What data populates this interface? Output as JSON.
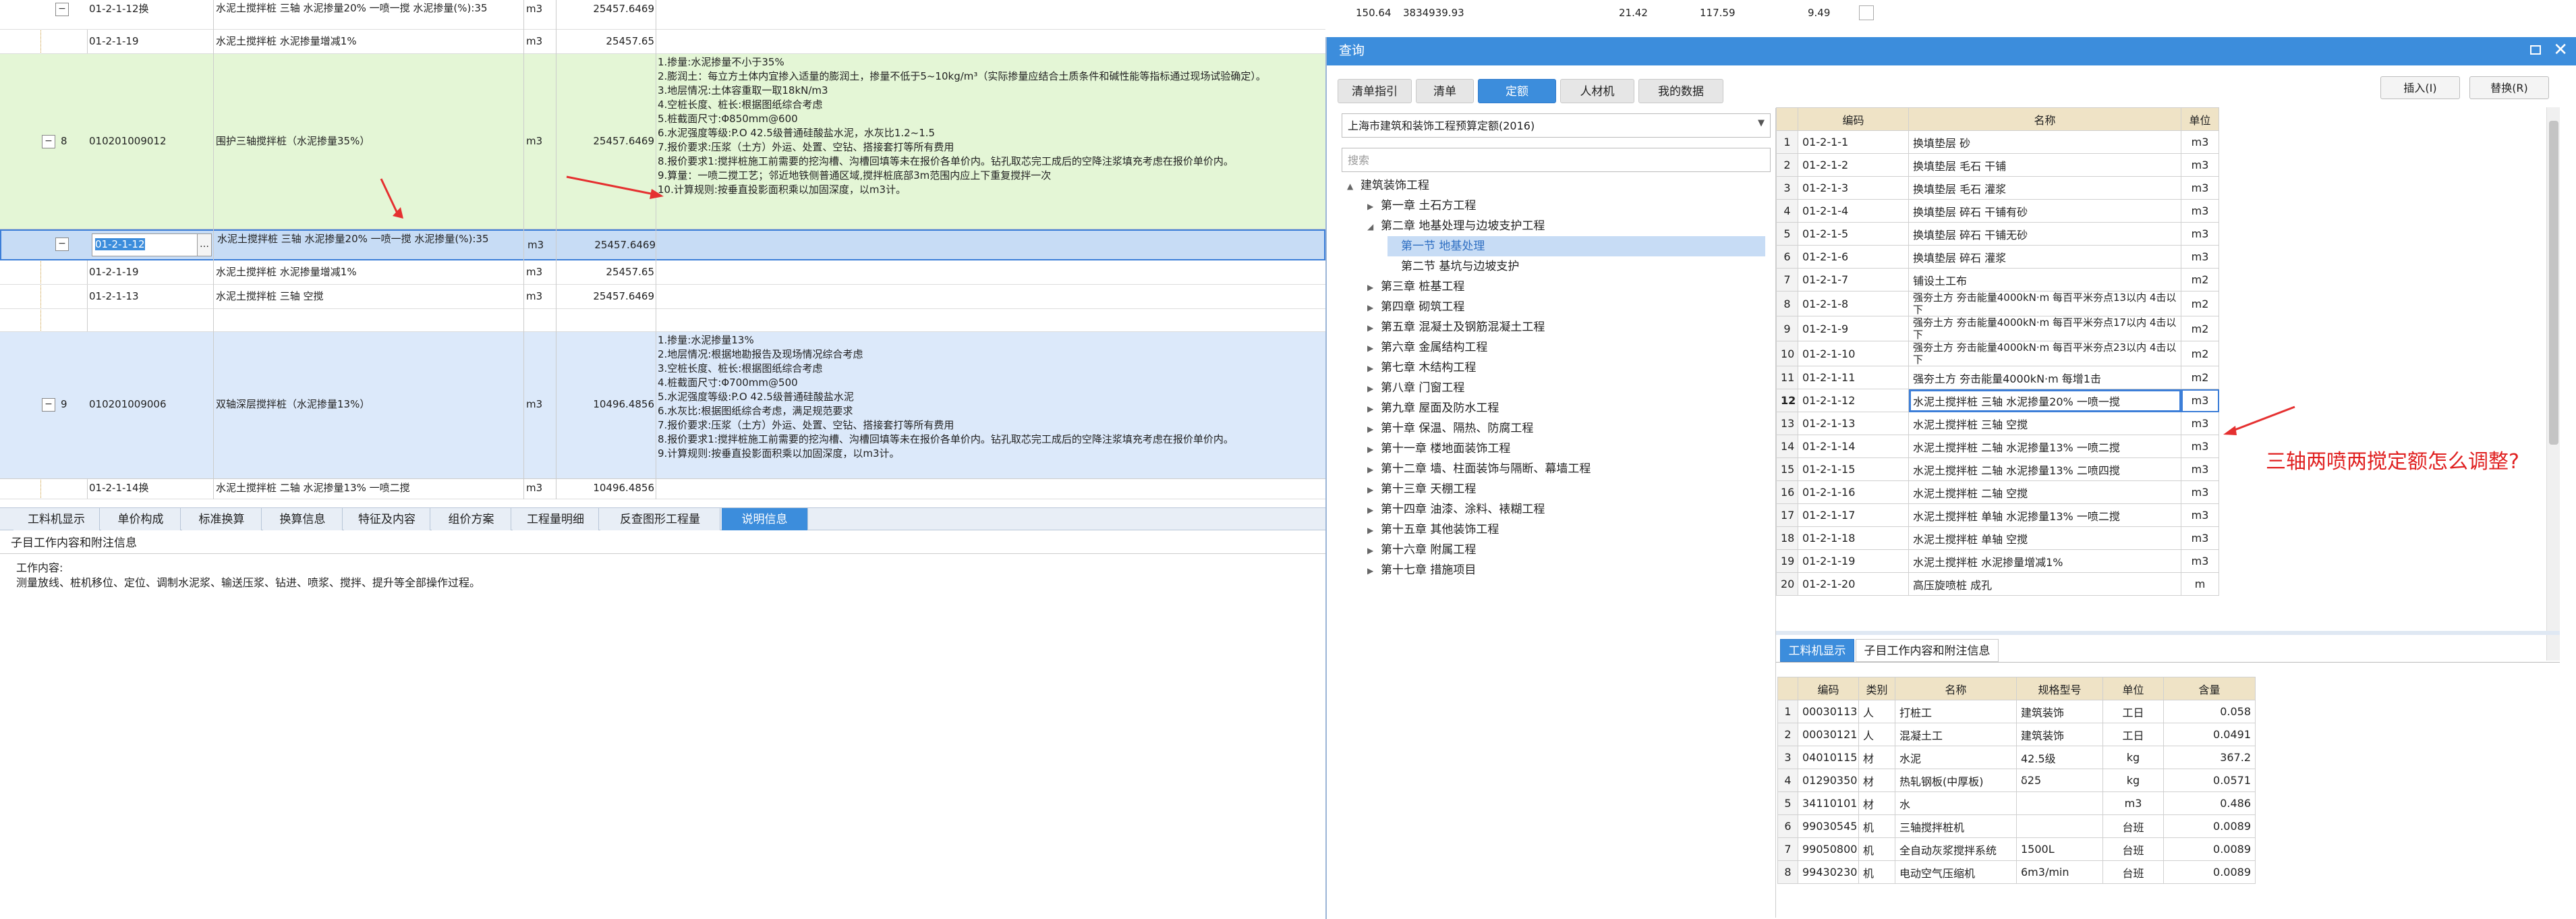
{
  "top_rows": [
    {
      "code": "01-2-1-12换",
      "name": "水泥土搅拌桩 三轴 水泥掺量20% 一喷一搅 水泥掺量(%):35",
      "unit": "m3",
      "qty": "25457.6469"
    },
    {
      "code": "01-2-1-19",
      "name": "水泥土搅拌桩 水泥掺量增减1%",
      "unit": "m3",
      "qty": "25457.65"
    }
  ],
  "top_right": {
    "v1": "150.64",
    "v2": "3834939.93",
    "v3": "21.42",
    "v4": "117.59",
    "v5": "9.49"
  },
  "row8": {
    "seq": "8",
    "code": "010201009012",
    "name": "围护三轴搅拌桩（水泥掺量35%）",
    "unit": "m3",
    "qty": "25457.6469",
    "desc": "1.掺量:水泥掺量不小于35%\n2.膨润土：每立方土体内宜掺入适量的膨润土，掺量不低于5~10kg/m³（实际掺量应结合土质条件和碱性能等指标通过现场试验确定）。\n3.地层情况:土体容重取一取18kN/m3\n4.空桩长度、桩长:根据图纸综合考虑\n5.桩截面尺寸:Φ850mm@600\n6.水泥强度等级:P.O 42.5级普通硅酸盐水泥，水灰比1.2~1.5\n7.报价要求:压浆（土方）外运、处置、空钻、搭接套打等所有费用\n8.报价要求1:搅拌桩施工前需要的挖沟槽、沟槽回填等未在报价各单价内。钻孔取芯完工成后的空降注浆填充考虑在报价单价内。\n9.算量：一喷二搅工艺；邻近地铁侧普通区域,搅拌桩底部3m范围内应上下重复搅拌一次\n10.计算规则:按垂直投影面积乘以加固深度，以m3计。"
  },
  "row_sel": {
    "code": "01-2-1-12",
    "name": "水泥土搅拌桩 三轴 水泥掺量20% 一喷一搅 水泥掺量(%):35",
    "unit": "m3",
    "qty": "25457.6469"
  },
  "sub_rows": [
    {
      "code": "01-2-1-19",
      "name": "水泥土搅拌桩 水泥掺量增减1%",
      "unit": "m3",
      "qty": "25457.65"
    },
    {
      "code": "01-2-1-13",
      "name": "水泥土搅拌桩 三轴 空搅",
      "unit": "m3",
      "qty": "25457.6469"
    }
  ],
  "row9": {
    "seq": "9",
    "code": "010201009006",
    "name": "双轴深层搅拌桩（水泥掺量13%）",
    "unit": "m3",
    "qty": "10496.4856",
    "desc": "1.掺量:水泥掺量13%\n2.地层情况:根据地勘报告及现场情况综合考虑\n3.空桩长度、桩长:根据图纸综合考虑\n4.桩截面尺寸:Φ700mm@500\n5.水泥强度等级:P.O 42.5级普通硅酸盐水泥\n6.水灰比:根据图纸综合考虑，满足规范要求\n7.报价要求:压浆（土方）外运、处置、空钻、搭接套打等所有费用\n8.报价要求1:搅拌桩施工前需要的挖沟槽、沟槽回填等未在报价各单价内。钻孔取芯完工成后的空降注浆填充考虑在报价单价内。\n9.计算规则:按垂直投影面积乘以加固深度，以m3计。"
  },
  "row_last": {
    "code": "01-2-1-14换",
    "name": "水泥土搅拌桩 二轴 水泥掺量13% 一喷二搅",
    "unit": "m3",
    "qty": "10496.4856"
  },
  "bottom_tabs": [
    "工料机显示",
    "单价构成",
    "标准换算",
    "换算信息",
    "特征及内容",
    "组价方案",
    "工程量明细",
    "反查图形工程量",
    "说明信息"
  ],
  "bottom_active": "说明信息",
  "bottom_panel": {
    "header": "子目工作内容和附注信息",
    "label": "工作内容:",
    "content": "测量放线、桩机移位、定位、调制水泥浆、输送压浆、钻进、喷浆、搅拌、提升等全部操作过程。"
  },
  "dialog": {
    "title": "查询",
    "tabs": [
      "清单指引",
      "清单",
      "定额",
      "人材机",
      "我的数据"
    ],
    "active_tab": "定额",
    "insert_label": "插入(I)",
    "replace_label": "替换(R)",
    "library": "上海市建筑和装饰工程预算定额(2016)",
    "search_placeholder": "搜索",
    "tree": [
      {
        "label": "建筑装饰工程",
        "level": 0,
        "toggle": "▲"
      },
      {
        "label": "第一章 土石方工程",
        "level": 1,
        "toggle": "▶"
      },
      {
        "label": "第二章 地基处理与边坡支护工程",
        "level": 1,
        "toggle": "◢"
      },
      {
        "label": "第一节 地基处理",
        "level": 2,
        "toggle": "",
        "selected": true
      },
      {
        "label": "第二节 基坑与边坡支护",
        "level": 2,
        "toggle": ""
      },
      {
        "label": "第三章 桩基工程",
        "level": 1,
        "toggle": "▶"
      },
      {
        "label": "第四章 砌筑工程",
        "level": 1,
        "toggle": "▶"
      },
      {
        "label": "第五章 混凝土及钢筋混凝土工程",
        "level": 1,
        "toggle": "▶"
      },
      {
        "label": "第六章 金属结构工程",
        "level": 1,
        "toggle": "▶"
      },
      {
        "label": "第七章 木结构工程",
        "level": 1,
        "toggle": "▶"
      },
      {
        "label": "第八章 门窗工程",
        "level": 1,
        "toggle": "▶"
      },
      {
        "label": "第九章 屋面及防水工程",
        "level": 1,
        "toggle": "▶"
      },
      {
        "label": "第十章 保温、隔热、防腐工程",
        "level": 1,
        "toggle": "▶"
      },
      {
        "label": "第十一章 楼地面装饰工程",
        "level": 1,
        "toggle": "▶"
      },
      {
        "label": "第十二章 墙、柱面装饰与隔断、幕墙工程",
        "level": 1,
        "toggle": "▶"
      },
      {
        "label": "第十三章 天棚工程",
        "level": 1,
        "toggle": "▶"
      },
      {
        "label": "第十四章 油漆、涂料、裱糊工程",
        "level": 1,
        "toggle": "▶"
      },
      {
        "label": "第十五章 其他装饰工程",
        "level": 1,
        "toggle": "▶"
      },
      {
        "label": "第十六章 附属工程",
        "level": 1,
        "toggle": "▶"
      },
      {
        "label": "第十七章 措施项目",
        "level": 1,
        "toggle": "▶"
      }
    ],
    "grid_headers": [
      "编码",
      "名称",
      "单位"
    ],
    "grid": [
      [
        "1",
        "01-2-1-1",
        "换填垫层 砂",
        "m3"
      ],
      [
        "2",
        "01-2-1-2",
        "换填垫层 毛石 干铺",
        "m3"
      ],
      [
        "3",
        "01-2-1-3",
        "换填垫层 毛石 灌浆",
        "m3"
      ],
      [
        "4",
        "01-2-1-4",
        "换填垫层 碎石 干铺有砂",
        "m3"
      ],
      [
        "5",
        "01-2-1-5",
        "换填垫层 碎石 干铺无砂",
        "m3"
      ],
      [
        "6",
        "01-2-1-6",
        "换填垫层 碎石 灌浆",
        "m3"
      ],
      [
        "7",
        "01-2-1-7",
        "铺设土工布",
        "m2"
      ],
      [
        "8",
        "01-2-1-8",
        "强夯土方 夯击能量4000kN·m 每百平米夯点13以内 4击以下",
        "m2"
      ],
      [
        "9",
        "01-2-1-9",
        "强夯土方 夯击能量4000kN·m 每百平米夯点17以内 4击以下",
        "m2"
      ],
      [
        "10",
        "01-2-1-10",
        "强夯土方 夯击能量4000kN·m 每百平米夯点23以内 4击以下",
        "m2"
      ],
      [
        "11",
        "01-2-1-11",
        "强夯土方 夯击能量4000kN·m 每增1击",
        "m2"
      ],
      [
        "12",
        "01-2-1-12",
        "水泥土搅拌桩 三轴 水泥掺量20% 一喷一搅",
        "m3"
      ],
      [
        "13",
        "01-2-1-13",
        "水泥土搅拌桩 三轴 空搅",
        "m3"
      ],
      [
        "14",
        "01-2-1-14",
        "水泥土搅拌桩 二轴 水泥掺量13% 一喷二搅",
        "m3"
      ],
      [
        "15",
        "01-2-1-15",
        "水泥土搅拌桩 二轴 水泥掺量13% 二喷四搅",
        "m3"
      ],
      [
        "16",
        "01-2-1-16",
        "水泥土搅拌桩 二轴 空搅",
        "m3"
      ],
      [
        "17",
        "01-2-1-17",
        "水泥土搅拌桩 单轴 水泥掺量13% 一喷二搅",
        "m3"
      ],
      [
        "18",
        "01-2-1-18",
        "水泥土搅拌桩 单轴 空搅",
        "m3"
      ],
      [
        "19",
        "01-2-1-19",
        "水泥土搅拌桩 水泥掺量增减1%",
        "m3"
      ],
      [
        "20",
        "01-2-1-20",
        "高压旋喷桩 成孔",
        "m"
      ]
    ],
    "annotation": "三轴两喷两搅定额怎么调整?",
    "res_tabs": [
      "工料机显示",
      "子目工作内容和附注信息"
    ],
    "res_headers": [
      "编码",
      "类别",
      "名称",
      "规格型号",
      "单位",
      "含量"
    ],
    "res_rows": [
      [
        "1",
        "00030113",
        "人",
        "打桩工",
        "建筑装饰",
        "工日",
        "0.058"
      ],
      [
        "2",
        "00030121",
        "人",
        "混凝土工",
        "建筑装饰",
        "工日",
        "0.0491"
      ],
      [
        "3",
        "04010115",
        "材",
        "水泥",
        "42.5级",
        "kg",
        "367.2"
      ],
      [
        "4",
        "01290350",
        "材",
        "热轧钢板(中厚板)",
        "δ25",
        "kg",
        "0.0571"
      ],
      [
        "5",
        "34110101",
        "材",
        "水",
        "",
        "m3",
        "0.486"
      ],
      [
        "6",
        "99030545",
        "机",
        "三轴搅拌桩机",
        "",
        "台班",
        "0.0089"
      ],
      [
        "7",
        "99050800",
        "机",
        "全自动灰浆搅拌系统",
        "1500L",
        "台班",
        "0.0089"
      ],
      [
        "8",
        "99430230",
        "机",
        "电动空气压缩机",
        "6m3/min",
        "台班",
        "0.0089"
      ]
    ]
  },
  "colors": {
    "green_row": "#e4f6d6",
    "blue_row": "#dce9fa",
    "selected": "#c7dcf5",
    "accent": "#3c8ddc",
    "arrow": "#e53030"
  }
}
